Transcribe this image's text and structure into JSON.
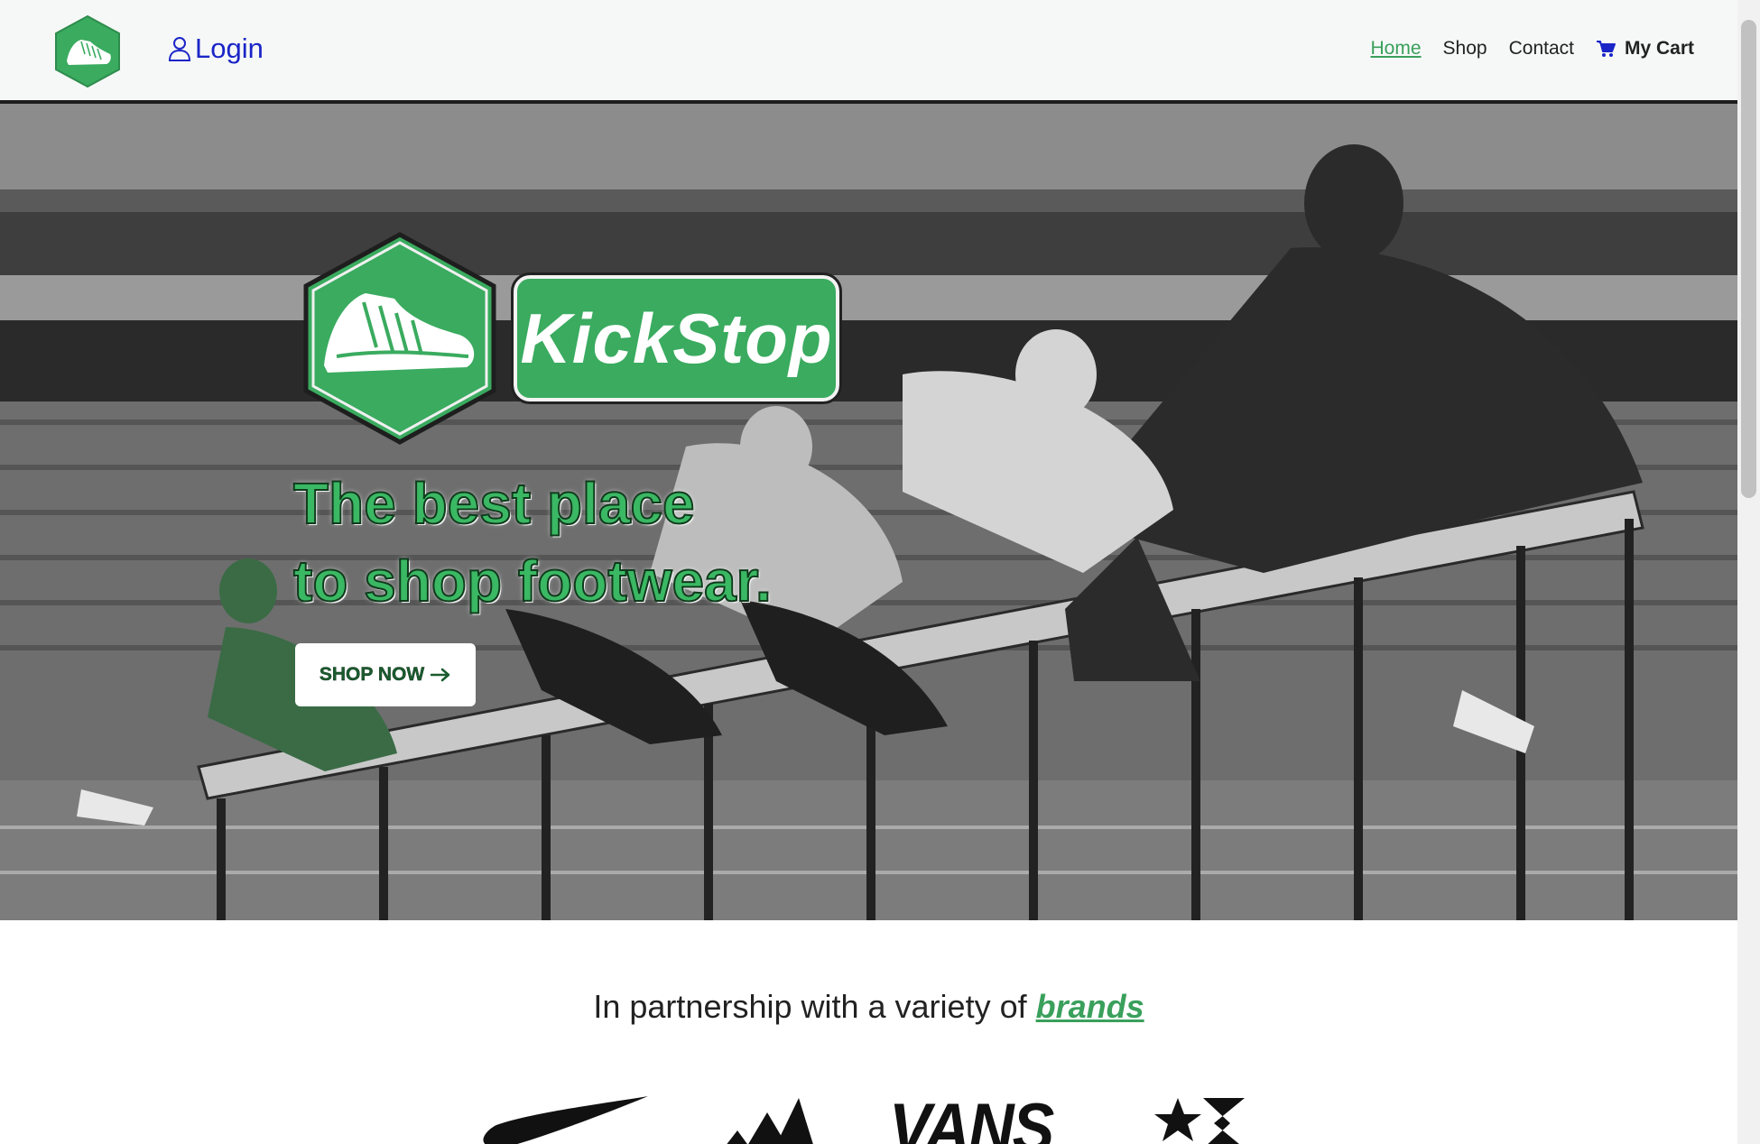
{
  "navbar": {
    "logo_icon": "sneaker-hexagon-logo",
    "login_label": "Login",
    "login_icon": "user-icon",
    "links": [
      {
        "label": "Home",
        "active": true
      },
      {
        "label": "Shop",
        "active": false
      },
      {
        "label": "Contact",
        "active": false
      }
    ],
    "cart_label": "My Cart",
    "cart_icon": "cart-icon"
  },
  "hero": {
    "brand_name": "KickStop",
    "tagline_line1": "The best place",
    "tagline_line2": "to shop footwear.",
    "cta_label": "SHOP NOW",
    "cta_icon": "arrow-right-icon",
    "background": "hurdlers-photo-grayscale"
  },
  "partners": {
    "heading_prefix": "In partnership with a variety of",
    "heading_link": "brands",
    "logos": [
      "nike",
      "adidas",
      "VANS",
      "converse"
    ]
  },
  "colors": {
    "brand_green": "#3aab5f",
    "link_green": "#3aa05c",
    "login_blue": "#1a25c7",
    "nav_bg": "#f6f8f7"
  }
}
